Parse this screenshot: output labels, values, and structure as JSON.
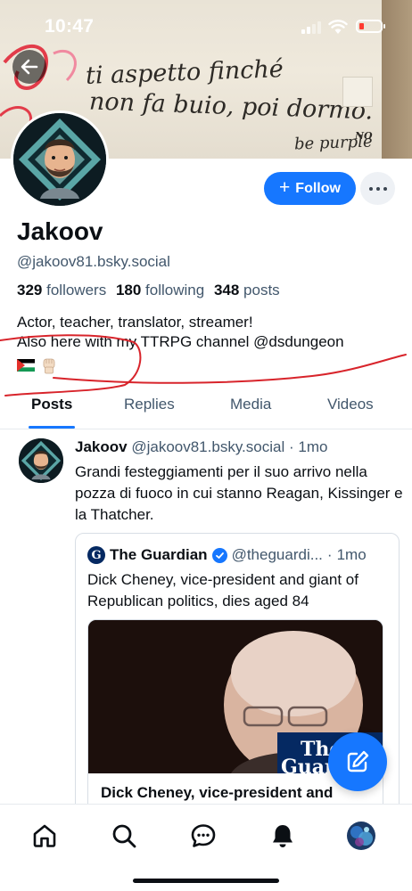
{
  "status_bar": {
    "time": "10:47"
  },
  "banner": {
    "graffiti_line1": "ti aspetto finché",
    "graffiti_line2": "non fa buio, poi dormo.",
    "graffiti_line3": "be purple",
    "graffiti_tag": "NO"
  },
  "profile": {
    "display_name": "Jakoov",
    "handle": "@jakoov81.bsky.social",
    "followers_count": "329",
    "followers_label": "followers",
    "following_count": "180",
    "following_label": "following",
    "posts_count": "348",
    "posts_label": "posts",
    "bio_line1": "Actor, teacher, translator, streamer!",
    "bio_line2": "Also here with my TTRPG channel @dsdungeon",
    "follow_label": "Follow"
  },
  "tabs": [
    {
      "label": "Posts",
      "active": true
    },
    {
      "label": "Replies",
      "active": false
    },
    {
      "label": "Media",
      "active": false
    },
    {
      "label": "Videos",
      "active": false
    }
  ],
  "post": {
    "author": "Jakoov",
    "handle": "@jakoov81.bsky.social",
    "separator": "·",
    "age": "1mo",
    "text": "Grandi festeggiamenti per il suo arrivo nella pozza di fuoco in cui stanno Reagan, Kissinger e la Thatcher.",
    "quote": {
      "author": "The Guardian",
      "handle": "@theguardi...",
      "age": "1mo",
      "text": "Dick Cheney, vice-president and giant of Republican politics, dies aged 84",
      "card_title": "Dick Cheney, vice-president and",
      "logo_text_1": "The",
      "logo_text_2": "Guar"
    }
  },
  "colors": {
    "accent": "#1677ff",
    "text_primary": "#0b0f14",
    "text_secondary": "#42576c",
    "annotation_red": "#d8242b",
    "guardian_blue": "#052962"
  },
  "icons": {
    "back": "arrow-left-icon",
    "more": "ellipsis-icon",
    "verified": "check-badge-icon",
    "compose": "pencil-square-icon",
    "home": "home-icon",
    "search": "search-icon",
    "chat": "chat-bubble-icon",
    "notifications": "bell-icon"
  }
}
